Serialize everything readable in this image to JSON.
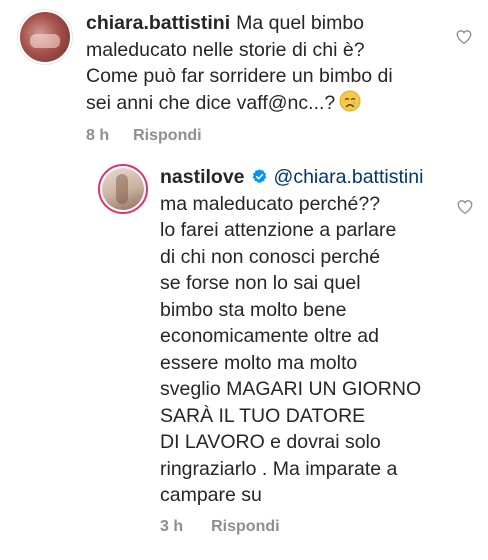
{
  "comments": [
    {
      "username": "chiara.battistini",
      "text": "Ma quel bimbo\nmaleducato nelle storie di chi è?\nCome può far sorridere un bimbo di\nsei anni che dice vaff@nc...?",
      "emoji": "crying-face-icon",
      "time": "8 h",
      "reply_label": "Rispondi"
    }
  ],
  "reply": {
    "username": "nastilove",
    "verified": true,
    "mention": "@chiara.battistini",
    "text": "ma maleducato perché??\nlo farei attenzione a parlare\ndi chi non conosci perché\nse forse non lo sai quel\nbimbo sta molto bene\neconomicamente oltre ad\nessere molto ma molto\nsveglio MAGARI UN GIORNO\nSARÀ IL TUO DATORE\nDI LAVORO e dovrai solo\nringraziarlo . Ma imparate a\ncampare su",
    "time": "3 h",
    "reply_label": "Rispondi"
  },
  "colors": {
    "text": "#262626",
    "meta": "#8e8e8e",
    "mention": "#00376b",
    "verified": "#0095f6",
    "story_ring": "#e1306c"
  }
}
